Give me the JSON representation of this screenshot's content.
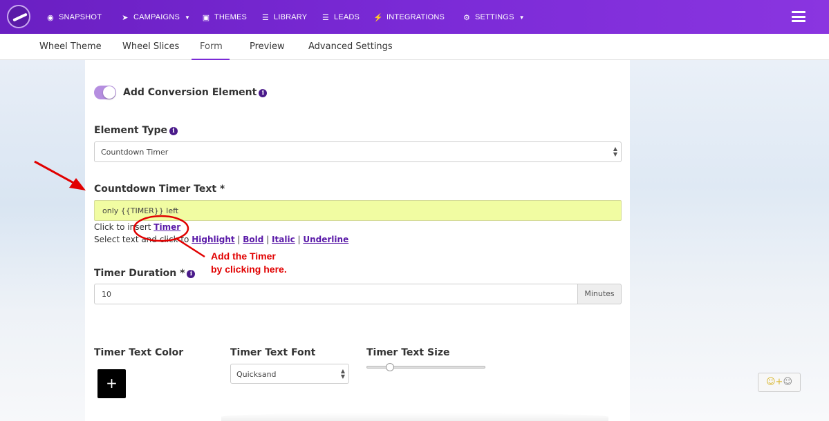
{
  "nav": {
    "items": [
      {
        "label": "SNAPSHOT",
        "icon": "dashboard-icon"
      },
      {
        "label": "CAMPAIGNS",
        "icon": "paper-plane-icon",
        "dropdown": true
      },
      {
        "label": "THEMES",
        "icon": "image-icon"
      },
      {
        "label": "LIBRARY",
        "icon": "library-icon"
      },
      {
        "label": "LEADS",
        "icon": "list-icon"
      },
      {
        "label": "INTEGRATIONS",
        "icon": "plug-icon"
      },
      {
        "label": "SETTINGS",
        "icon": "gears-icon",
        "dropdown": true
      }
    ],
    "brand_color": "#7a2ad6"
  },
  "tabs": [
    {
      "label": "Wheel Theme"
    },
    {
      "label": "Wheel Slices"
    },
    {
      "label": "Form",
      "active": true
    },
    {
      "label": "Preview"
    },
    {
      "label": "Advanced Settings"
    }
  ],
  "form": {
    "conversion_toggle_label": "Add Conversion Element",
    "conversion_toggle_on": true,
    "element_type_label": "Element Type",
    "element_type_value": "Countdown Timer",
    "timer_text_label": "Countdown Timer Text *",
    "timer_text_value": "only {{TIMER}} left",
    "insert_prefix": "Click to insert ",
    "insert_link": "Timer",
    "select_prefix": "Select text and click to ",
    "highlight_link": "Highlight",
    "bold_link": "Bold",
    "italic_link": "Italic",
    "underline_link": "Underline",
    "separator": " | ",
    "duration_label": "Timer Duration *",
    "duration_value": "10",
    "duration_unit": "Minutes",
    "text_color_label": "Timer Text Color",
    "color_button_glyph": "+",
    "text_font_label": "Timer Text Font",
    "text_font_value": "Quicksand",
    "text_size_label": "Timer Text Size",
    "text_size_level": 0.2
  },
  "annotation": {
    "line1": "Add the Timer",
    "line2": "by clicking here.",
    "color": "#e10000"
  },
  "feedback": {
    "icon": "emoji-icon"
  }
}
